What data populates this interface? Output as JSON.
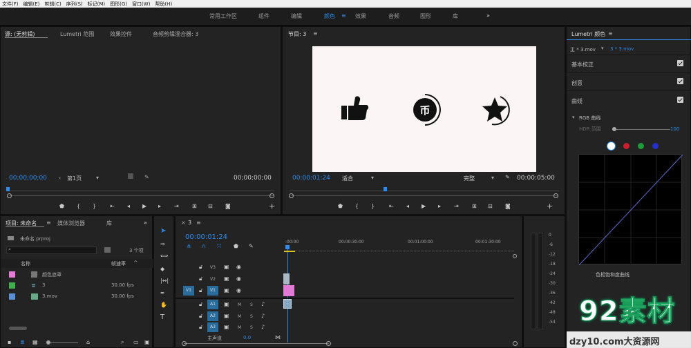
{
  "menu": [
    "文件(F)",
    "编辑(E)",
    "剪辑(C)",
    "序列(S)",
    "标记(M)",
    "图形(G)",
    "窗口(W)",
    "帮助(H)"
  ],
  "workspaces": {
    "items": [
      "常用工作区",
      "组件",
      "编辑",
      "颜色",
      "效果",
      "音频",
      "图形",
      "库"
    ],
    "active": "颜色",
    "more": "»",
    "menu_icon": "≡"
  },
  "source": {
    "tabs": [
      "源: (无剪辑)",
      "Lumetri 范围",
      "效果控件",
      "音频剪辑混合器: 3"
    ],
    "tc_left": "00;00;00;00",
    "page": "第1页",
    "tc_right": "00;00;00;00"
  },
  "program": {
    "title": "节目: 3",
    "menu_icon": "≡",
    "tc_left": "00:00:01:24",
    "fit": "适合",
    "quality": "完整",
    "tc_right": "00:00:05:00"
  },
  "lumetri": {
    "title": "Lumetri 颜色",
    "menu_icon": "≡",
    "master": "主 * 3.mov",
    "clip": "3 * 3.mov",
    "basic": "基本校正",
    "creative": "创意",
    "curves": "曲线",
    "rgb_curves": "RGB 曲线",
    "hdr": "HDR 范围",
    "hdr_value": "100",
    "bottom_label": "色相饱和度曲线",
    "colors": {
      "white": "#ffffff",
      "red": "#c8202a",
      "green": "#1d9c3a",
      "blue": "#2430c8"
    }
  },
  "project": {
    "title": "项目: 未命名",
    "menu_icon": "≡",
    "tabs": [
      "媒体浏览器",
      "库"
    ],
    "more": "»",
    "file": "未命名.prproj",
    "count": "3 个项",
    "col_name": "名称",
    "col_rate": "帧速率",
    "items": [
      {
        "name": "颜色遮罩",
        "rate": "",
        "color": "#e27ad6"
      },
      {
        "name": "3",
        "rate": "30.00 fps",
        "color": "#3fb04c"
      },
      {
        "name": "3.mov",
        "rate": "30.00 fps",
        "color": "#5b8fd6"
      }
    ]
  },
  "timeline": {
    "seq": "3",
    "menu_icon": "≡",
    "tc": "00:00:01:24",
    "ruler": [
      ":00:00",
      "00:00:30:00",
      "00:01:00:00",
      "00:01:30:00"
    ],
    "video_tracks": [
      "V3",
      "V2",
      "V1"
    ],
    "audio_tracks": [
      "A1",
      "A2",
      "A3"
    ],
    "src_v": "V1",
    "master": "主声道",
    "master_val": "0.0",
    "m": "M",
    "s": "S"
  },
  "meters": [
    "0",
    "-6",
    "-12",
    "-18",
    "-24",
    "-30",
    "-36",
    "-42",
    "-48",
    "-54"
  ],
  "watermark": {
    "big": "92素材",
    "small": "dzy10.com大资源网"
  }
}
